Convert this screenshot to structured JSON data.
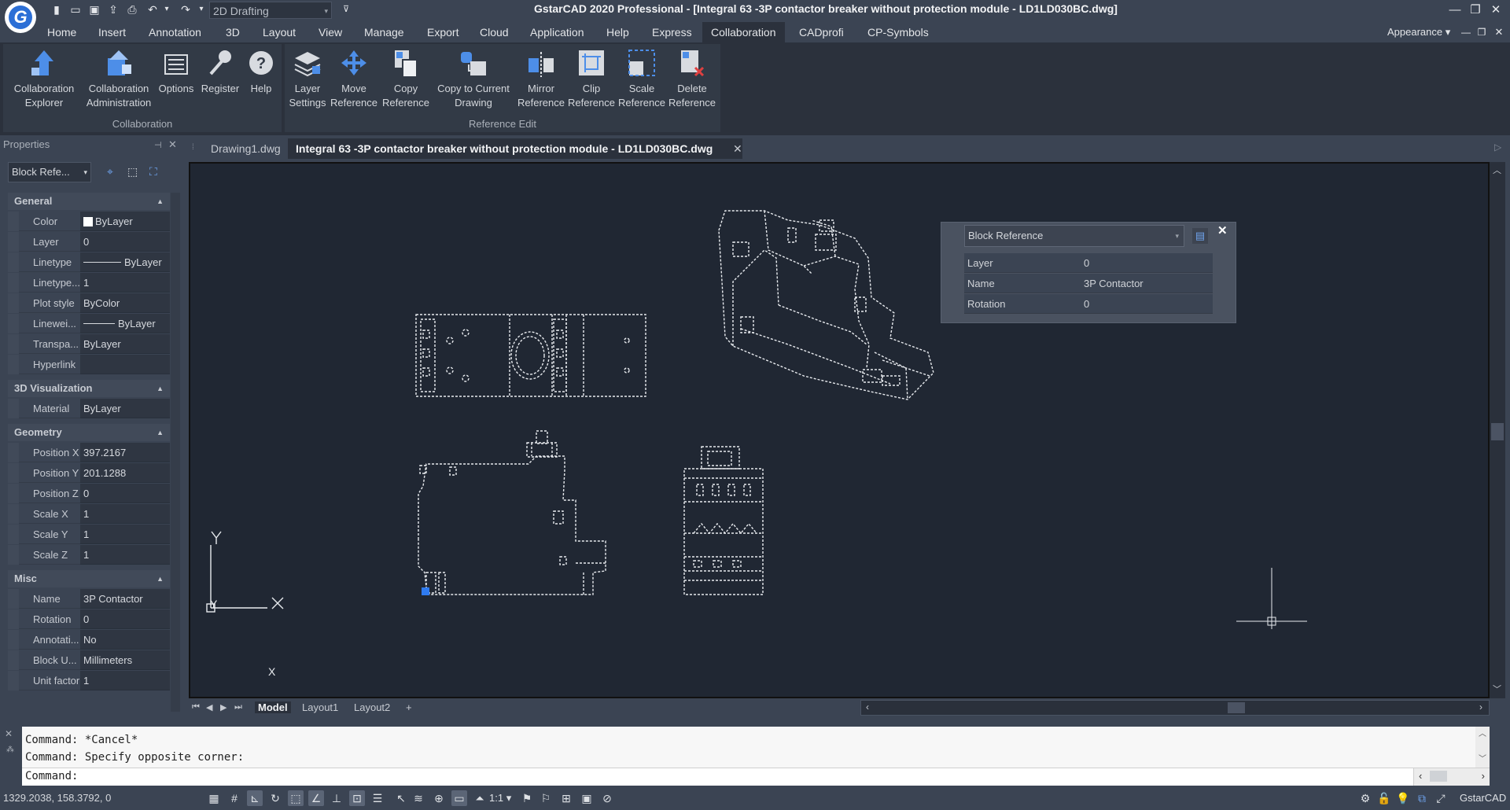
{
  "titlebar": {
    "workspace": "2D Drafting",
    "title": "GstarCAD 2020 Professional - [Integral 63 -3P contactor breaker without protection module - LD1LD030BC.dwg]"
  },
  "menus": [
    "Home",
    "Insert",
    "Annotation",
    "3D",
    "Layout",
    "View",
    "Manage",
    "Export",
    "Cloud",
    "Application",
    "Help",
    "Express",
    "Collaboration",
    "CADprofi",
    "CP-Symbols"
  ],
  "menu_active": "Collaboration",
  "appearance": "Appearance",
  "ribbon": {
    "collab_panel_title": "Collaboration",
    "refedit_panel_title": "Reference Edit",
    "collab_buttons": [
      {
        "l1": "Collaboration",
        "l2": "Explorer"
      },
      {
        "l1": "Collaboration",
        "l2": "Administration"
      },
      {
        "l1": "Options",
        "l2": ""
      },
      {
        "l1": "Register",
        "l2": ""
      },
      {
        "l1": "Help",
        "l2": ""
      }
    ],
    "refedit_buttons": [
      {
        "l1": "Layer",
        "l2": "Settings"
      },
      {
        "l1": "Move",
        "l2": "Reference"
      },
      {
        "l1": "Copy",
        "l2": "Reference"
      },
      {
        "l1": "Copy to Current",
        "l2": "Drawing"
      },
      {
        "l1": "Mirror",
        "l2": "Reference"
      },
      {
        "l1": "Clip",
        "l2": "Reference"
      },
      {
        "l1": "Scale",
        "l2": "Reference"
      },
      {
        "l1": "Delete",
        "l2": "Reference"
      }
    ]
  },
  "properties": {
    "title": "Properties",
    "selector": "Block Refe...",
    "sections": {
      "general": "General",
      "viz": "3D Visualization",
      "geometry": "Geometry",
      "misc": "Misc"
    },
    "general": [
      {
        "k": "Color",
        "v": "ByLayer"
      },
      {
        "k": "Layer",
        "v": "0"
      },
      {
        "k": "Linetype",
        "v": "ByLayer"
      },
      {
        "k": "Linetype...",
        "v": "1"
      },
      {
        "k": "Plot style",
        "v": "ByColor"
      },
      {
        "k": "Linewei...",
        "v": "ByLayer"
      },
      {
        "k": "Transpa...",
        "v": "ByLayer"
      },
      {
        "k": "Hyperlink",
        "v": ""
      }
    ],
    "viz": [
      {
        "k": "Material",
        "v": "ByLayer"
      }
    ],
    "geometry": [
      {
        "k": "Position X",
        "v": "397.2167"
      },
      {
        "k": "Position Y",
        "v": "201.1288"
      },
      {
        "k": "Position Z",
        "v": "0"
      },
      {
        "k": "Scale X",
        "v": "1"
      },
      {
        "k": "Scale Y",
        "v": "1"
      },
      {
        "k": "Scale Z",
        "v": "1"
      }
    ],
    "misc": [
      {
        "k": "Name",
        "v": "3P Contactor"
      },
      {
        "k": "Rotation",
        "v": "0"
      },
      {
        "k": "Annotati...",
        "v": "No"
      },
      {
        "k": "Block U...",
        "v": "Millimeters"
      },
      {
        "k": "Unit factor",
        "v": "1"
      }
    ]
  },
  "doc_tabs": [
    "Drawing1.dwg",
    "Integral 63 -3P contactor breaker without protection module - LD1LD030BC.dwg"
  ],
  "layout_tabs": [
    "Model",
    "Layout1",
    "Layout2",
    "+"
  ],
  "quick_props": {
    "type": "Block Reference",
    "rows": [
      {
        "k": "Layer",
        "v": "0"
      },
      {
        "k": "Name",
        "v": "3P Contactor"
      },
      {
        "k": "Rotation",
        "v": "0"
      }
    ]
  },
  "ucs": {
    "x": "X",
    "y": "Y"
  },
  "command": {
    "line1": "Command: *Cancel*",
    "line2": "Command: Specify opposite corner:",
    "prompt": "Command:"
  },
  "status": {
    "coords": "1329.2038, 158.3792, 0",
    "scale": "1:1",
    "app": "GstarCAD"
  }
}
